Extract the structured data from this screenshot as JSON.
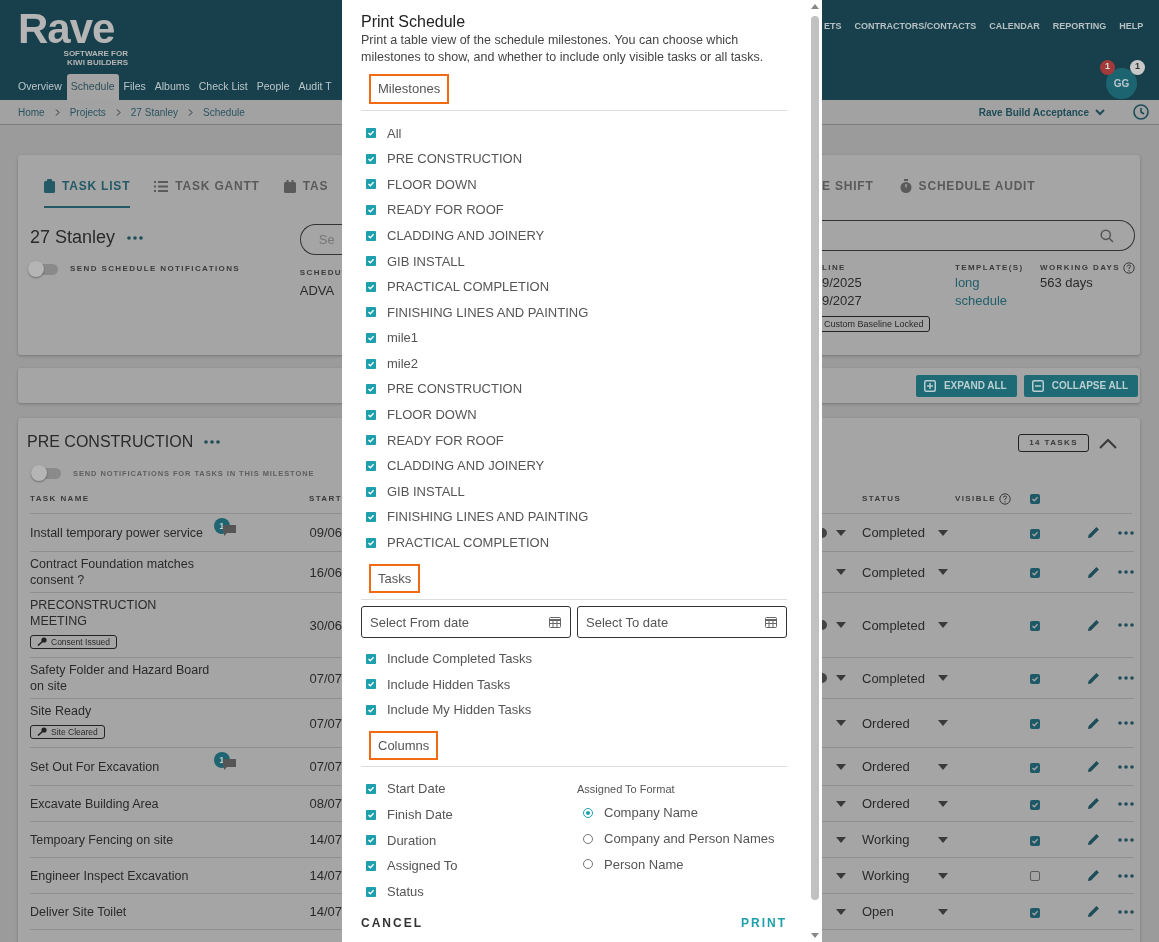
{
  "header": {
    "logo": "Rave",
    "tagline": [
      "SOFTWARE FOR",
      "KIWI BUILDERS"
    ],
    "project_tabs": [
      {
        "label": "Overview",
        "selected": false
      },
      {
        "label": "Schedule",
        "selected": true
      },
      {
        "label": "Files",
        "selected": false
      },
      {
        "label": "Albums",
        "selected": false
      },
      {
        "label": "Check List",
        "selected": false
      },
      {
        "label": "People",
        "selected": false
      },
      {
        "label": "Audit T",
        "selected": false
      }
    ],
    "main_nav": [
      "ETS",
      "CONTRACTORS/CONTACTS",
      "CALENDAR",
      "REPORTING",
      "HELP"
    ],
    "avatar": {
      "initials": "GG",
      "badges": [
        {
          "count": "1",
          "color": "#a33a3a"
        },
        {
          "count": "1",
          "color": "#c8c8c8"
        }
      ]
    }
  },
  "breadcrumb": [
    "Home",
    "Projects",
    "27 Stanley",
    "Schedule"
  ],
  "account": "Rave Build Acceptance",
  "schedule_card": {
    "view_tabs": [
      {
        "label": "TASK LIST",
        "selected": true
      },
      {
        "label": "TASK GANTT",
        "selected": false
      },
      {
        "label": "TAS",
        "selected": false
      },
      {
        "label": "E SHIFT",
        "selected": false
      },
      {
        "label": "SCHEDULE AUDIT",
        "selected": false
      }
    ],
    "project_name": "27 Stanley",
    "notifications_toggle": {
      "label": "SEND SCHEDULE NOTIFICATIONS",
      "on": false
    },
    "search_placeholder": "Se",
    "schedule_label": "SCHEDU",
    "schedule_value": "ADVA",
    "baseline_label": "LINE",
    "baseline_dates": [
      "9/2025",
      "9/2027"
    ],
    "baseline_tag": "Custom Baseline Locked",
    "templates_label": "TEMPLATE(S)",
    "templates_link": "long schedule",
    "working_days_label": "WORKING DAYS",
    "working_days": "563 days"
  },
  "toolbar": [
    {
      "label": "EXPAND ALL",
      "kind": "expand"
    },
    {
      "label": "COLLAPSE ALL",
      "kind": "collapse"
    }
  ],
  "milestone": {
    "title": "PRE CONSTRUCTION",
    "toggle": {
      "label": "SEND NOTIFICATIONS FOR TASKS IN THIS MILESTONE",
      "on": false
    },
    "task_count": "14 TASKS",
    "expanded": true,
    "columns": {
      "name": "TASK NAME",
      "start": "START",
      "status": "STATUS",
      "visible": "VISIBLE"
    },
    "all_visible": true,
    "tasks": [
      {
        "name": "Install temporary power service",
        "comments": "1",
        "start": "09/06",
        "status": "Completed",
        "visible": true,
        "clearable": true
      },
      {
        "name": "Contract Foundation matches consent ?",
        "start": "16/06",
        "status": "Completed",
        "visible": true,
        "clearable": false
      },
      {
        "name": "PRECONSTRUCTION MEETING",
        "tag": "Consent Issued",
        "start": "30/06",
        "status": "Completed",
        "visible": true,
        "clearable": true
      },
      {
        "name": "Safety Folder and Hazard Board on site",
        "start": "07/07",
        "status": "Completed",
        "visible": true,
        "clearable": true
      },
      {
        "name": "Site Ready",
        "tag": "Site Cleared",
        "start": "07/07",
        "status": "Ordered",
        "visible": true,
        "clearable": false
      },
      {
        "name": "Set Out For Excavation",
        "comments": "1",
        "start": "07/07",
        "status": "Ordered",
        "visible": true,
        "clearable": false
      },
      {
        "name": "Excavate Building Area",
        "start": "08/07",
        "status": "Ordered",
        "visible": true,
        "clearable": false
      },
      {
        "name": "Tempoary Fencing on site",
        "start": "14/07",
        "status": "Working",
        "visible": true,
        "clearable": false
      },
      {
        "name": "Engineer Inspect Excavation",
        "start": "14/07",
        "status": "Working",
        "visible": false,
        "clearable": false
      },
      {
        "name": "Deliver Site Toilet",
        "start": "14/07",
        "status": "Open",
        "visible": true,
        "clearable": false
      }
    ]
  },
  "dialog": {
    "title": "Print Schedule",
    "description": "Print a table view of the schedule milestones. You can choose which milestones to show, and whether to include only visible tasks or all tasks.",
    "milestones_heading": {
      "text": "Milestones",
      "highlighted": true
    },
    "milestones": [
      {
        "label": "All",
        "checked": true
      },
      {
        "label": "PRE CONSTRUCTION",
        "checked": true
      },
      {
        "label": "FLOOR DOWN",
        "checked": true
      },
      {
        "label": "READY FOR ROOF",
        "checked": true
      },
      {
        "label": "CLADDING AND JOINERY",
        "checked": true
      },
      {
        "label": "GIB INSTALL",
        "checked": true
      },
      {
        "label": "PRACTICAL COMPLETION",
        "checked": true
      },
      {
        "label": "FINISHING LINES AND PAINTING",
        "checked": true
      },
      {
        "label": "mile1",
        "checked": true
      },
      {
        "label": "mile2",
        "checked": true
      },
      {
        "label": "PRE CONSTRUCTION",
        "checked": true
      },
      {
        "label": "FLOOR DOWN",
        "checked": true
      },
      {
        "label": "READY FOR ROOF",
        "checked": true
      },
      {
        "label": "CLADDING AND JOINERY",
        "checked": true
      },
      {
        "label": "GIB INSTALL",
        "checked": true
      },
      {
        "label": "FINISHING LINES AND PAINTING",
        "checked": true
      },
      {
        "label": "PRACTICAL COMPLETION",
        "checked": true
      }
    ],
    "tasks_heading": {
      "text": "Tasks",
      "highlighted": true
    },
    "date_fields": [
      {
        "placeholder": "Select From date"
      },
      {
        "placeholder": "Select To date"
      }
    ],
    "task_options": [
      {
        "label": "Include Completed Tasks",
        "checked": true
      },
      {
        "label": "Include Hidden Tasks",
        "checked": true
      },
      {
        "label": "Include My Hidden Tasks",
        "checked": true
      }
    ],
    "columns_heading": {
      "text": "Columns",
      "highlighted": true
    },
    "column_options": [
      {
        "label": "Start Date",
        "checked": true
      },
      {
        "label": "Finish Date",
        "checked": true
      },
      {
        "label": "Duration",
        "checked": true
      },
      {
        "label": "Assigned To",
        "checked": true
      },
      {
        "label": "Status",
        "checked": true
      }
    ],
    "assigned_format": {
      "label": "Assigned To Format",
      "options": [
        {
          "label": "Company Name",
          "selected": true
        },
        {
          "label": "Company and Person Names",
          "selected": false
        },
        {
          "label": "Person Name",
          "selected": false
        }
      ]
    },
    "buttons": [
      {
        "label": "CANCEL",
        "kind": "cancel"
      },
      {
        "label": "PRINT",
        "kind": "primary"
      }
    ]
  }
}
